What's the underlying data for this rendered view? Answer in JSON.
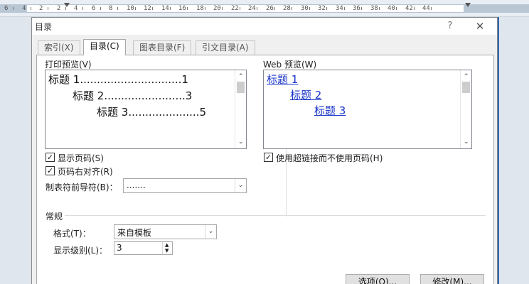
{
  "ruler": {
    "numbers": [
      "6",
      "4",
      "2",
      "2",
      "4",
      "6",
      "8",
      "10",
      "12",
      "14",
      "16",
      "18",
      "20",
      "22",
      "24",
      "26",
      "28",
      "30",
      "32",
      "34",
      "36",
      "38",
      "40",
      "42",
      "44"
    ]
  },
  "dialog": {
    "title": "目录",
    "help": "?",
    "close": "✕"
  },
  "tabs": [
    {
      "label": "索引(X)"
    },
    {
      "label": "目录(C)"
    },
    {
      "label": "图表目录(F)"
    },
    {
      "label": "引文目录(A)"
    }
  ],
  "print_preview": {
    "label": "打印预览(V)",
    "lines": [
      {
        "text": "标题 1",
        "dots": "..............................",
        "page": "1"
      },
      {
        "text": "标题 2",
        "dots": "........................",
        "page": "3"
      },
      {
        "text": "标题 3",
        "dots": ".....................",
        "page": "5"
      }
    ]
  },
  "web_preview": {
    "label": "Web 预览(W)",
    "links": [
      "标题 1",
      "标题 2",
      "标题 3"
    ]
  },
  "options": {
    "show_page_numbers": {
      "label": "显示页码(S)",
      "checked": true
    },
    "right_align": {
      "label": "页码右对齐(R)",
      "checked": true
    },
    "tab_leader": {
      "label": "制表符前导符(B)：",
      "value": "......."
    },
    "use_hyperlinks": {
      "label": "使用超链接而不使用页码(H)",
      "checked": true
    }
  },
  "general": {
    "heading": "常规",
    "format_label": "格式(T)：",
    "format_value": "来自模板",
    "levels_label": "显示级别(L)：",
    "levels_value": "3"
  },
  "buttons": {
    "options": "选项(O)...",
    "modify": "修改(M)..."
  },
  "icons": {
    "checkmark": "✓",
    "dropdown": "⌄",
    "scroll_up": "⌃",
    "scroll_down": "⌄"
  }
}
